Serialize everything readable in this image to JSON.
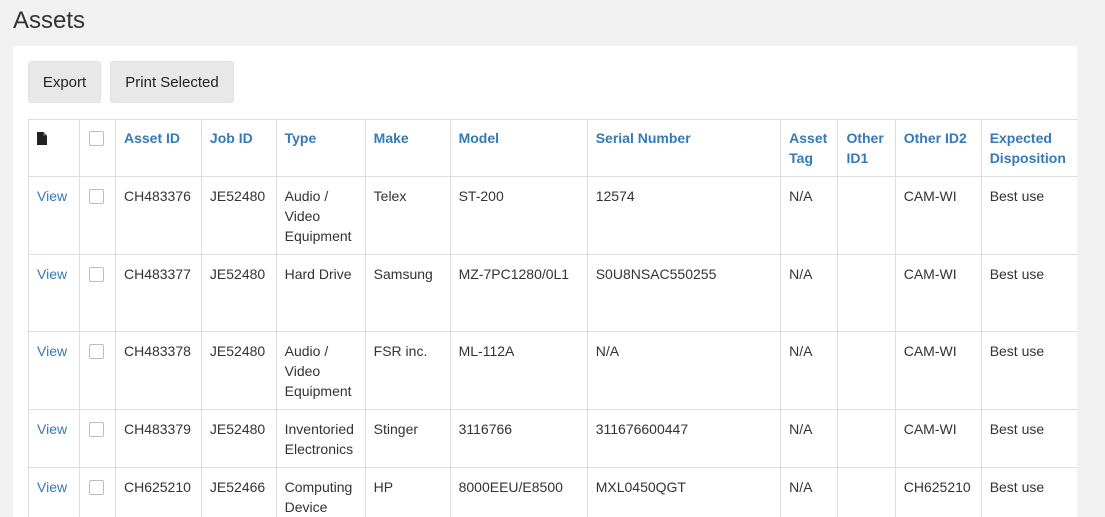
{
  "page": {
    "title": "Assets"
  },
  "toolbar": {
    "export_label": "Export",
    "print_selected_label": "Print Selected"
  },
  "table": {
    "columns": {
      "icon": "document-icon",
      "asset_id": "Asset ID",
      "job_id": "Job ID",
      "type": "Type",
      "make": "Make",
      "model": "Model",
      "serial": "Serial Number",
      "asset_tag": "Asset Tag",
      "other_id1": "Other ID1",
      "other_id2": "Other ID2",
      "expected_disposition": "Expected Disposition"
    },
    "rows": [
      {
        "view": "View",
        "asset_id": "CH483376",
        "job_id": "JE52480",
        "type": "Audio / Video Equipment",
        "make": "Telex",
        "model": "ST-200",
        "serial": "12574",
        "asset_tag": "N/A",
        "other_id1": "",
        "other_id2": "CAM-WI",
        "disposition": "Best use"
      },
      {
        "view": "View",
        "asset_id": "CH483377",
        "job_id": "JE52480",
        "type": "Hard Drive",
        "make": "Samsung",
        "model": "MZ-7PC1280/0L1",
        "serial": "S0U8NSAC550255",
        "asset_tag": "N/A",
        "other_id1": "",
        "other_id2": "CAM-WI",
        "disposition": "Best use"
      },
      {
        "view": "View",
        "asset_id": "CH483378",
        "job_id": "JE52480",
        "type": "Audio / Video Equipment",
        "make": "FSR inc.",
        "model": "ML-112A",
        "serial": "N/A",
        "asset_tag": "N/A",
        "other_id1": "",
        "other_id2": "CAM-WI",
        "disposition": "Best use"
      },
      {
        "view": "View",
        "asset_id": "CH483379",
        "job_id": "JE52480",
        "type": "Inventoried Electronics",
        "make": "Stinger",
        "model": "3116766",
        "serial": "311676600447",
        "asset_tag": "N/A",
        "other_id1": "",
        "other_id2": "CAM-WI",
        "disposition": "Best use"
      },
      {
        "view": "View",
        "asset_id": "CH625210",
        "job_id": "JE52466",
        "type": "Computing Device",
        "make": "HP",
        "model": "8000EEU/E8500",
        "serial": "MXL0450QGT",
        "asset_tag": "N/A",
        "other_id1": "",
        "other_id2": "CH625210",
        "disposition": "Best use"
      }
    ]
  },
  "colors": {
    "link": "#337ab7",
    "panel_bg": "#ffffff",
    "page_bg": "#f1f1f1",
    "border": "#dddddd"
  }
}
